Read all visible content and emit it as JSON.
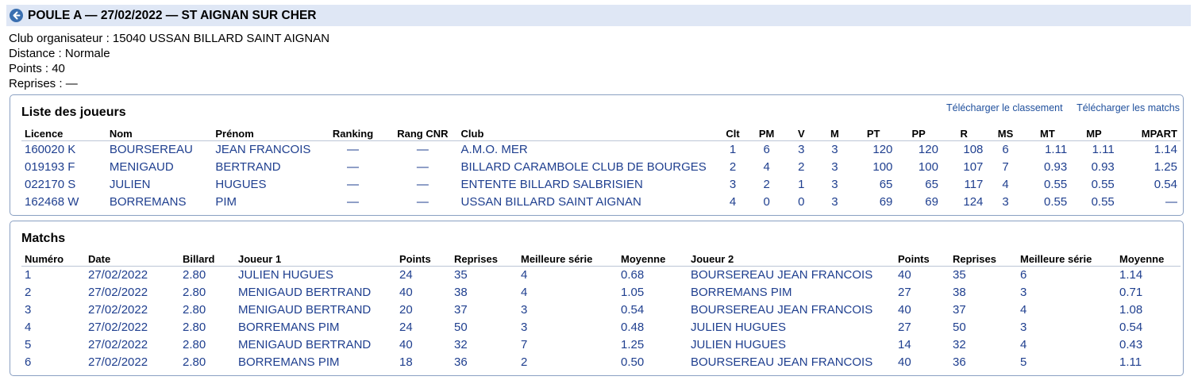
{
  "header": {
    "title": "POULE A — 27/02/2022 — ST AIGNAN SUR CHER",
    "back_icon": "arrow-left-circle-icon"
  },
  "info": {
    "organisateur": "Club organisateur : 15040 USSAN BILLARD SAINT AIGNAN",
    "distance": "Distance : Normale",
    "points": "Points : 40",
    "reprises": "Reprises : —"
  },
  "players": {
    "title": "Liste des joueurs",
    "download_ranking": "Télécharger le classement",
    "download_matches": "Télécharger les matchs",
    "columns": [
      "Licence",
      "Nom",
      "Prénom",
      "Ranking",
      "Rang CNR",
      "Club",
      "Clt",
      "PM",
      "V",
      "M",
      "PT",
      "PP",
      "R",
      "MS",
      "MT",
      "MP",
      "MPART"
    ],
    "rows": [
      [
        "160020 K",
        "BOURSEREAU",
        "JEAN FRANCOIS",
        "—",
        "—",
        "A.M.O. MER",
        "1",
        "6",
        "3",
        "3",
        "120",
        "120",
        "108",
        "6",
        "1.11",
        "1.11",
        "1.14"
      ],
      [
        "019193 F",
        "MENIGAUD",
        "BERTRAND",
        "—",
        "—",
        "BILLARD CARAMBOLE CLUB DE BOURGES",
        "2",
        "4",
        "2",
        "3",
        "100",
        "100",
        "107",
        "7",
        "0.93",
        "0.93",
        "1.25"
      ],
      [
        "022170 S",
        "JULIEN",
        "HUGUES",
        "—",
        "—",
        "ENTENTE BILLARD SALBRISIEN",
        "3",
        "2",
        "1",
        "3",
        "65",
        "65",
        "117",
        "4",
        "0.55",
        "0.55",
        "0.54"
      ],
      [
        "162468 W",
        "BORREMANS",
        "PIM",
        "—",
        "—",
        "USSAN BILLARD SAINT AIGNAN",
        "4",
        "0",
        "0",
        "3",
        "69",
        "69",
        "124",
        "3",
        "0.55",
        "0.55",
        "—"
      ]
    ]
  },
  "matches": {
    "title": "Matchs",
    "columns": [
      "Numéro",
      "Date",
      "Billard",
      "Joueur 1",
      "Points",
      "Reprises",
      "Meilleure série",
      "Moyenne",
      "Joueur 2",
      "Points",
      "Reprises",
      "Meilleure série",
      "Moyenne"
    ],
    "rows": [
      [
        "1",
        "27/02/2022",
        "2.80",
        "JULIEN HUGUES",
        "24",
        "35",
        "4",
        "0.68",
        "BOURSEREAU JEAN FRANCOIS",
        "40",
        "35",
        "6",
        "1.14"
      ],
      [
        "2",
        "27/02/2022",
        "2.80",
        "MENIGAUD BERTRAND",
        "40",
        "38",
        "4",
        "1.05",
        "BORREMANS PIM",
        "27",
        "38",
        "3",
        "0.71"
      ],
      [
        "3",
        "27/02/2022",
        "2.80",
        "MENIGAUD BERTRAND",
        "20",
        "37",
        "3",
        "0.54",
        "BOURSEREAU JEAN FRANCOIS",
        "40",
        "37",
        "4",
        "1.08"
      ],
      [
        "4",
        "27/02/2022",
        "2.80",
        "BORREMANS PIM",
        "24",
        "50",
        "3",
        "0.48",
        "JULIEN HUGUES",
        "27",
        "50",
        "3",
        "0.54"
      ],
      [
        "5",
        "27/02/2022",
        "2.80",
        "MENIGAUD BERTRAND",
        "40",
        "32",
        "7",
        "1.25",
        "JULIEN HUGUES",
        "14",
        "32",
        "4",
        "0.43"
      ],
      [
        "6",
        "27/02/2022",
        "2.80",
        "BORREMANS PIM",
        "18",
        "36",
        "2",
        "0.50",
        "BOURSEREAU JEAN FRANCOIS",
        "40",
        "36",
        "5",
        "1.11"
      ]
    ]
  }
}
